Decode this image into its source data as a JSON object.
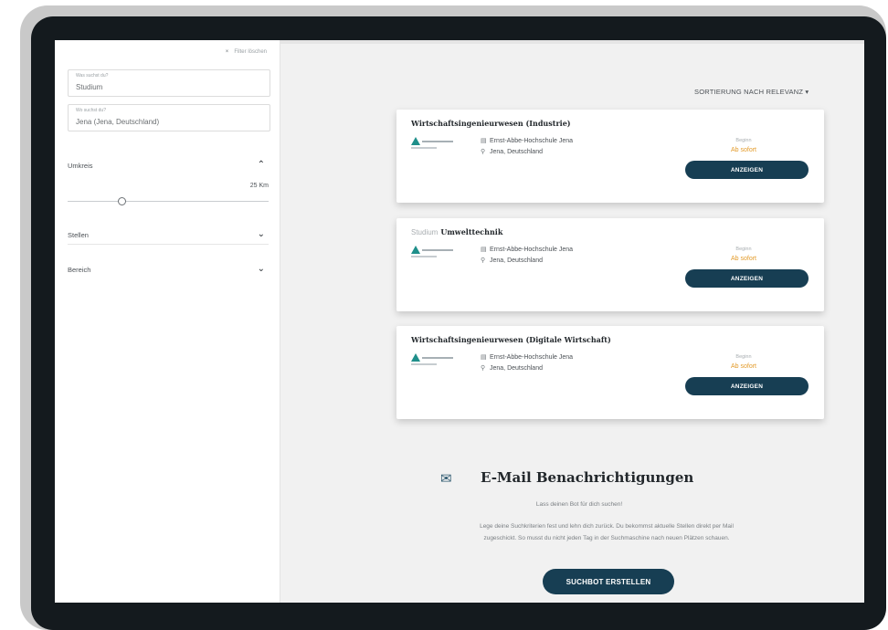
{
  "sidebar": {
    "reset_label": "Filter löschen",
    "what_field": {
      "label": "Was suchst du?",
      "value": "Studium"
    },
    "where_field": {
      "label": "Wo suchst du?",
      "value": "Jena (Jena, Deutschland)"
    },
    "umkreis": {
      "label": "Umkreis",
      "value_label": "25 Km",
      "slider_fraction": 0.27
    },
    "stellen_label": "Stellen",
    "bereich_label": "Bereich"
  },
  "main": {
    "sort_label": "SORTIERUNG NACH RELEVANZ",
    "results": [
      {
        "prefix": "",
        "title": "Wirtschaftsingenieurwesen (Industrie)",
        "institution": "Ernst-Abbe-Hochschule Jena",
        "location": "Jena, Deutschland",
        "beginn_label": "Beginn",
        "beginn_value": "Ab sofort",
        "button_label": "ANZEIGEN"
      },
      {
        "prefix": "Studium",
        "title": "Umwelttechnik",
        "institution": "Ernst-Abbe-Hochschule Jena",
        "location": "Jena, Deutschland",
        "beginn_label": "Beginn",
        "beginn_value": "Ab sofort",
        "button_label": "ANZEIGEN"
      },
      {
        "prefix": "",
        "title": "Wirtschaftsingenieurwesen (Digitale Wirtschaft)",
        "institution": "Ernst-Abbe-Hochschule Jena",
        "location": "Jena, Deutschland",
        "beginn_label": "Beginn",
        "beginn_value": "Ab sofort",
        "button_label": "ANZEIGEN"
      }
    ],
    "email": {
      "title": "E-Mail Benachrichtigungen",
      "subtitle": "Lass deinen Bot für dich suchen!",
      "description": "Lege deine Suchkriterien fest und lehn dich zurück. Du bekommst aktuelle Stellen direkt per Mail zugeschickt. So musst du nicht jeden Tag in der Suchmaschine nach neuen Plätzen schauen.",
      "button_label": "SUCHBOT ERSTELLEN"
    }
  },
  "colors": {
    "primary_button": "#173e53",
    "accent": "#e39b2a",
    "logo_teal": "#1f8f8a"
  },
  "icons": [
    "close-icon",
    "chevron-up-icon",
    "chevron-down-icon",
    "building-icon",
    "location-pin-icon",
    "mail-icon",
    "caret-down-icon"
  ]
}
